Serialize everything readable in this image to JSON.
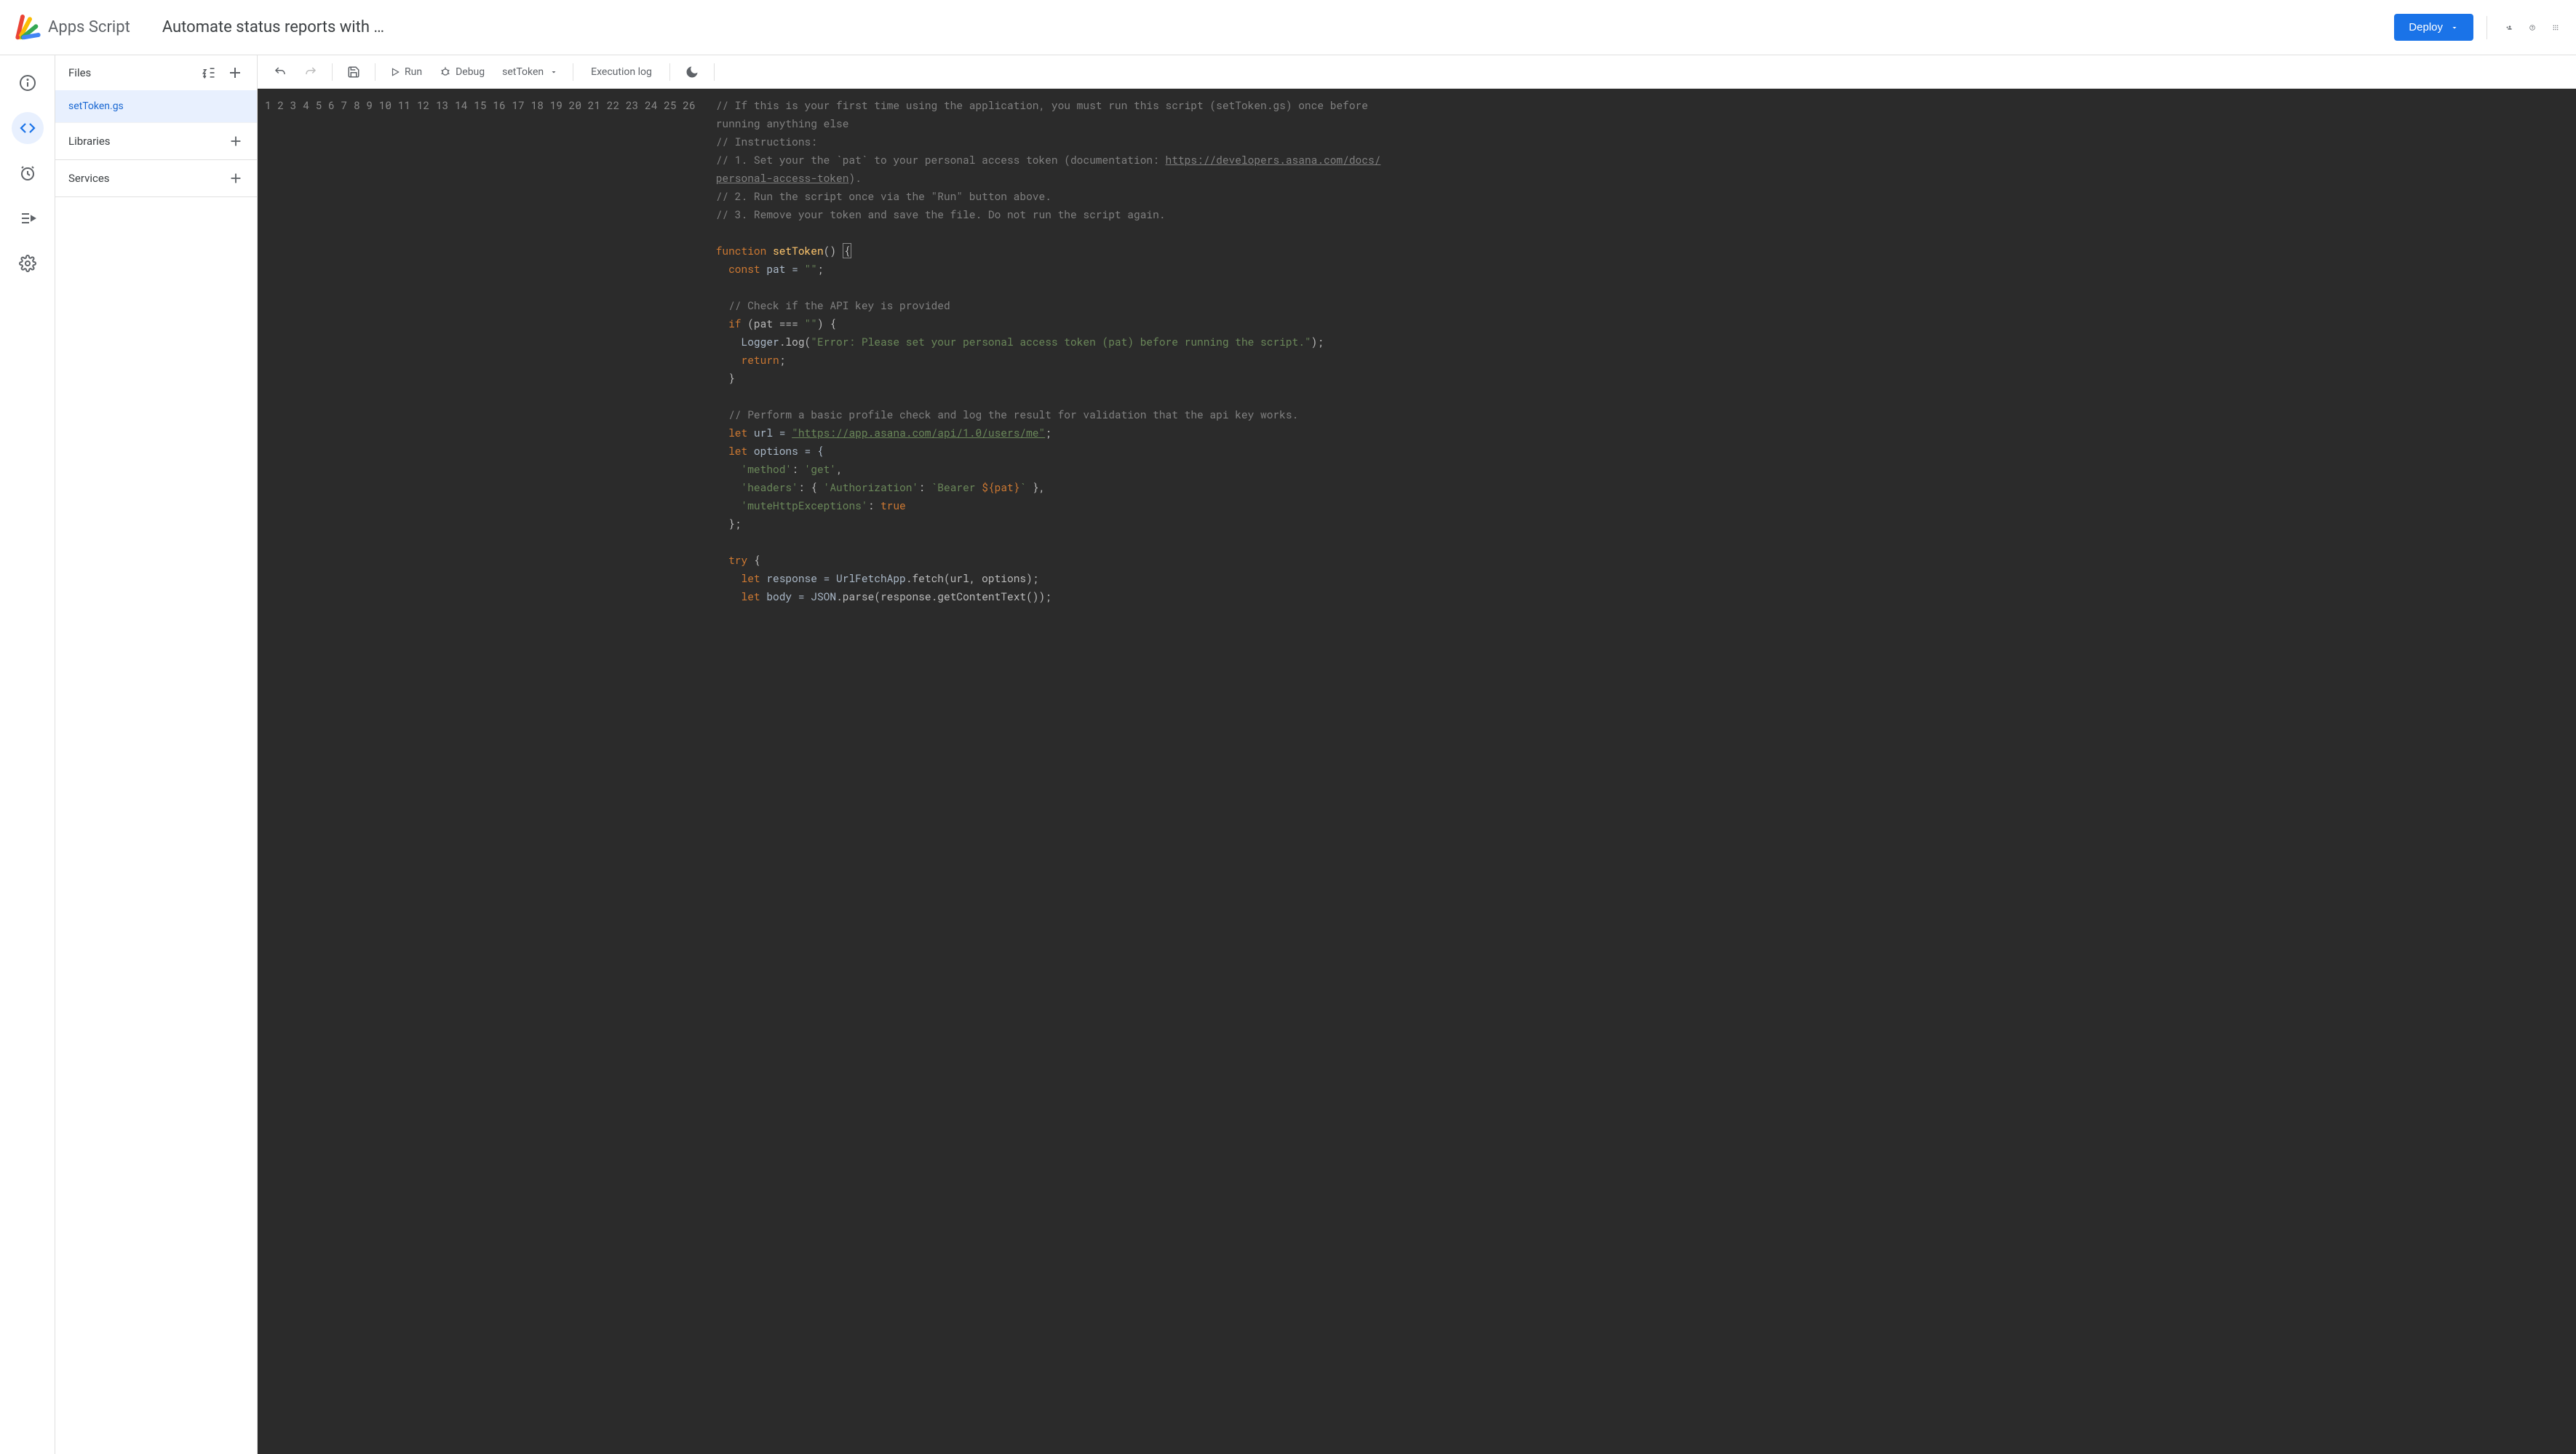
{
  "header": {
    "app_name": "Apps Script",
    "project_title": "Automate status reports with …",
    "deploy_label": "Deploy"
  },
  "left_rail": {
    "overview": "Overview",
    "editor": "Editor",
    "triggers": "Triggers",
    "executions": "Executions",
    "settings": "Project Settings"
  },
  "files_panel": {
    "files_label": "Files",
    "files": [
      {
        "name": "setToken.gs",
        "active": true
      }
    ],
    "libraries_label": "Libraries",
    "services_label": "Services"
  },
  "toolbar": {
    "run_label": "Run",
    "debug_label": "Debug",
    "function_selected": "setToken",
    "execution_log_label": "Execution log"
  },
  "code": {
    "line_numbers": [
      "1",
      "2",
      "3",
      "4",
      "5",
      "6",
      "7",
      "8",
      "9",
      "10",
      "11",
      "12",
      "13",
      "14",
      "15",
      "16",
      "17",
      "18",
      "19",
      "20",
      "21",
      "22",
      "23",
      "24",
      "25",
      "26"
    ],
    "lines": {
      "l1a": "// If this is your first time using the application, you must run this script (setToken.gs) once before ",
      "l1b": "running anything else",
      "l2": "// Instructions:",
      "l3a": "// 1. Set your the `pat` to your personal access token (documentation: ",
      "l3b_url": "https://developers.asana.com/docs/",
      "l3c_url": "personal-access-token",
      "l3d": ").",
      "l4": "// 2. Run the script once via the \"Run\" button above.",
      "l5": "// 3. Remove your token and save the file. Do not run the script again.",
      "l7_function": "function",
      "l7_name": "setToken",
      "l7_rest": "() ",
      "l7_brace": "{",
      "l8_const": "const",
      "l8_pat": " pat = ",
      "l8_str": "\"\"",
      "l8_semi": ";",
      "l10": "// Check if the API key is provided",
      "l11_if": "if",
      "l11_rest": " (pat === ",
      "l11_str": "\"\"",
      "l11_close": ") {",
      "l12_logger": "Logger",
      "l12_log": ".log(",
      "l12_str": "\"Error: Please set your personal access token (pat) before running the script.\"",
      "l12_close": ");",
      "l13_return": "return",
      "l13_semi": ";",
      "l14_brace": "}",
      "l16": "// Perform a basic profile check and log the result for validation that the api key works.",
      "l17_let": "let",
      "l17_url": " url = ",
      "l17_str": "\"https://app.asana.com/api/1.0/users/me\"",
      "l17_semi": ";",
      "l18_let": "let",
      "l18_rest": " options = {",
      "l19_key": "'method'",
      "l19_colon": ": ",
      "l19_val": "'get'",
      "l19_comma": ",",
      "l20_key": "'headers'",
      "l20_colon": ": { ",
      "l20_auth": "'Authorization'",
      "l20_colon2": ": ",
      "l20_template_open": "`Bearer ",
      "l20_template_var": "${pat}",
      "l20_template_close": "`",
      "l20_end": " },",
      "l21_key": "'muteHttpExceptions'",
      "l21_colon": ": ",
      "l21_true": "true",
      "l22": "};",
      "l24_try": "try",
      "l24_brace": " {",
      "l25_let": "let",
      "l25_resp": " response = ",
      "l25_urlfetch": "UrlFetchApp",
      "l25_fetch": ".fetch(url, options);",
      "l26_let": "let",
      "l26_body": " body = ",
      "l26_json": "JSON",
      "l26_parse": ".parse(response.getContentText());"
    }
  }
}
